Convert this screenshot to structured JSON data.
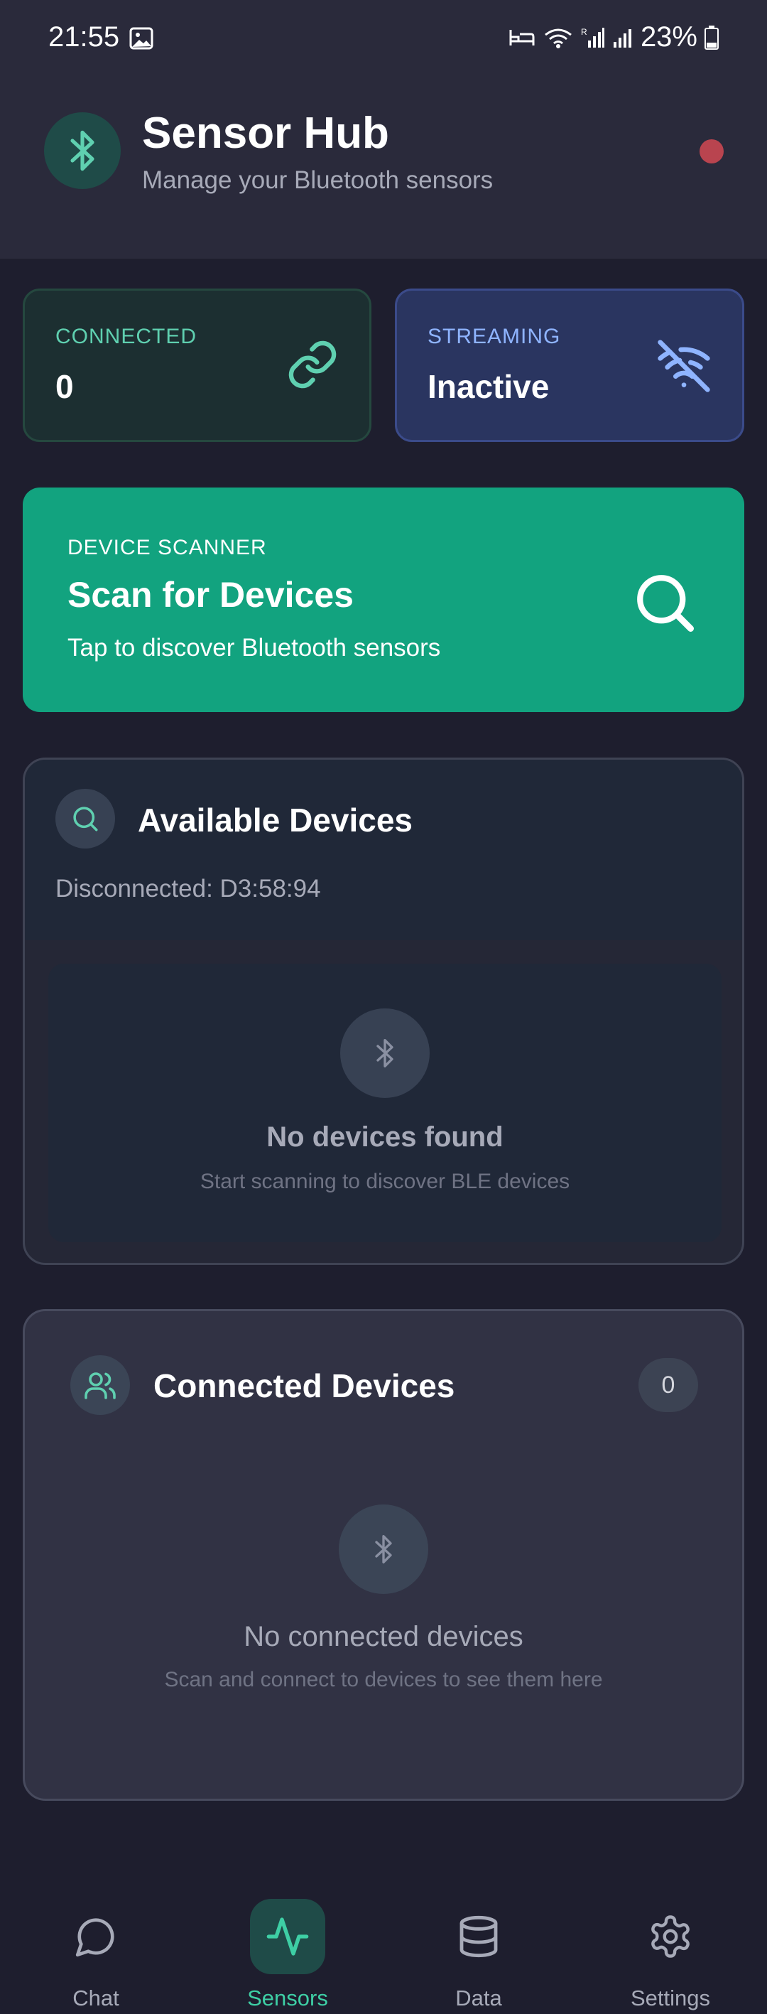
{
  "status_bar": {
    "time": "21:55",
    "battery": "23%",
    "icons": [
      "photo-icon",
      "sleep-icon",
      "wifi-icon",
      "signal-r-icon",
      "signal-icon",
      "battery-icon"
    ]
  },
  "header": {
    "title": "Sensor Hub",
    "subtitle": "Manage your Bluetooth sensors",
    "logo_icon": "bluetooth-icon",
    "status_dot_color": "#b9444f"
  },
  "stats": {
    "connected": {
      "label": "CONNECTED",
      "value": "0",
      "icon": "link-icon",
      "accent": "#5fd0b0"
    },
    "streaming": {
      "label": "STREAMING",
      "value": "Inactive",
      "icon": "wifi-off-icon",
      "accent": "#8fb4ff"
    }
  },
  "scanner": {
    "kicker": "DEVICE SCANNER",
    "title": "Scan for Devices",
    "subtitle": "Tap to discover Bluetooth sensors",
    "icon": "search-icon",
    "color": "#12a37f"
  },
  "available_devices": {
    "title": "Available Devices",
    "status": "Disconnected: D3:58:94",
    "empty_title": "No devices found",
    "empty_subtitle": "Start scanning to discover BLE devices"
  },
  "connected_devices": {
    "title": "Connected Devices",
    "count": "0",
    "empty_title": "No connected devices",
    "empty_subtitle": "Scan and connect to devices to see them here"
  },
  "bottom_nav": {
    "items": [
      {
        "label": "Chat",
        "icon": "chat-icon",
        "active": false
      },
      {
        "label": "Sensors",
        "icon": "activity-icon",
        "active": true
      },
      {
        "label": "Data",
        "icon": "database-icon",
        "active": false
      },
      {
        "label": "Settings",
        "icon": "settings-icon",
        "active": false
      }
    ],
    "active_color": "#3ecfa5"
  }
}
